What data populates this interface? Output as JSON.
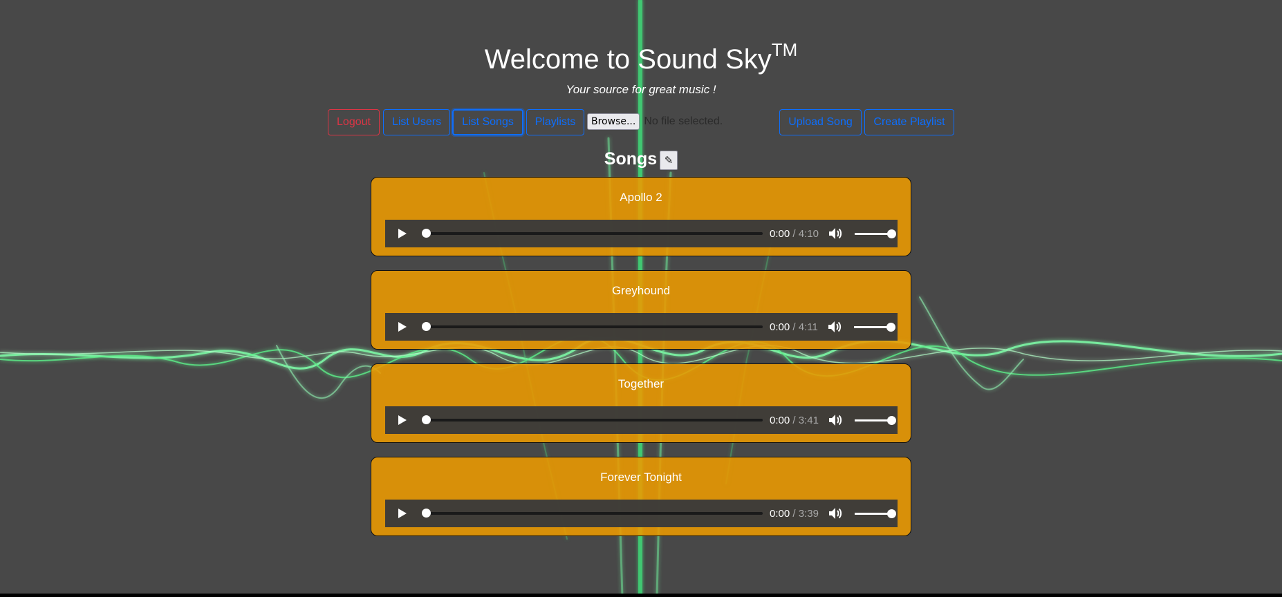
{
  "header": {
    "title": "Welcome to Sound Sky",
    "trademark": "TM",
    "tagline": "Your source for great music !"
  },
  "nav": {
    "logout": "Logout",
    "list_users": "List Users",
    "list_songs": "List Songs",
    "playlists": "Playlists",
    "browse": "Browse...",
    "file_status": "No file selected.",
    "upload_song": "Upload Song",
    "create_playlist": "Create Playlist"
  },
  "songs_section": {
    "heading": "Songs",
    "edit_icon": "pencil-icon"
  },
  "songs": [
    {
      "title": "Apollo 2",
      "current": "0:00",
      "separator": "/",
      "duration": "4:10"
    },
    {
      "title": "Greyhound",
      "current": "0:00",
      "separator": "/",
      "duration": "4:11"
    },
    {
      "title": "Together",
      "current": "0:00",
      "separator": "/",
      "duration": "3:41"
    },
    {
      "title": "Forever Tonight",
      "current": "0:00",
      "separator": "/",
      "duration": "3:39"
    }
  ],
  "colors": {
    "background": "#484848",
    "card": "#ec9a00",
    "primary": "#0d6efd",
    "danger": "#dc3545",
    "wave": "#5cf08a"
  }
}
